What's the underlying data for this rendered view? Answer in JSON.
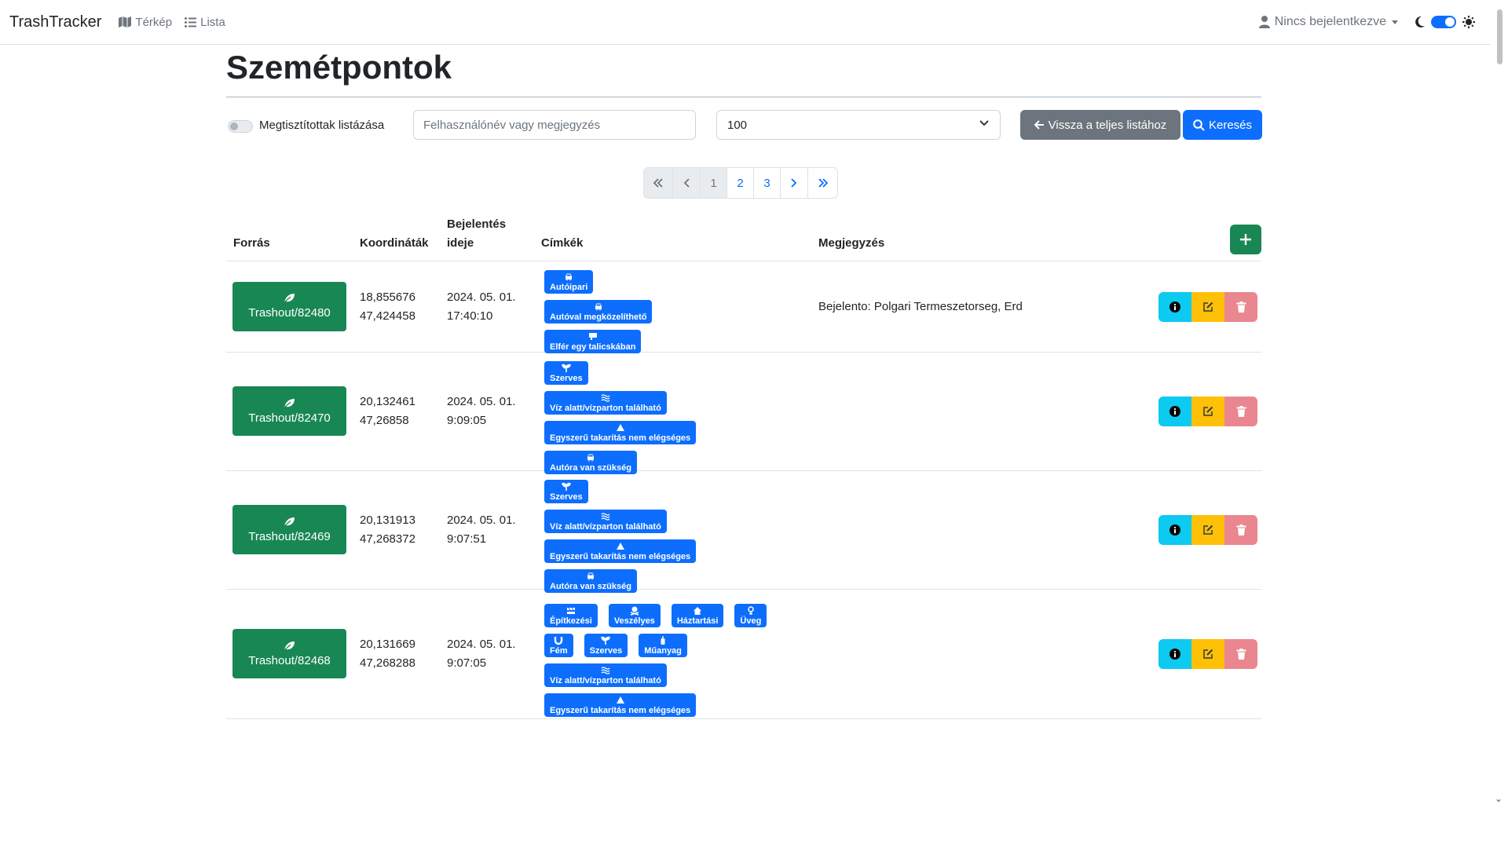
{
  "navbar": {
    "brand": "TrashTracker",
    "links": [
      {
        "label": "Térkép",
        "icon": "map-icon"
      },
      {
        "label": "Lista",
        "icon": "list-icon"
      }
    ],
    "user_menu": {
      "label": "Nincs bejelentkezve",
      "icon": "person-icon"
    },
    "theme_toggle": {
      "left_icon": "moon-icon",
      "right_icon": "sun-icon",
      "on": true
    }
  },
  "page": {
    "title": "Szemétpontok"
  },
  "filters": {
    "toggle_label": "Megtisztítottak listázása",
    "search_placeholder": "Felhasználónév vagy megjegyzés",
    "page_size": "100",
    "back_button": "Vissza a teljes listához",
    "search_button": "Keresés"
  },
  "pagination": {
    "first": "«",
    "prev": "‹",
    "pages": [
      "1",
      "2",
      "3"
    ],
    "next": "›",
    "last": "»",
    "current": "1"
  },
  "table": {
    "headers": {
      "source": "Forrás",
      "coords": "Koordináták",
      "date_line1": "Bejelentés",
      "date_line2": "ideje",
      "tags": "Címkék",
      "note": "Megjegyzés"
    },
    "rows": [
      {
        "source": "Trashout/82480",
        "coord_x": "18,855676",
        "coord_y": "47,424458",
        "date": "2024. 05. 01.",
        "time": "17:40:10",
        "tag_lines": [
          [
            {
              "label": "Autóipari",
              "icon": "car-icon"
            }
          ],
          [
            {
              "label": "Autóval megközelíthető",
              "icon": "car-icon"
            }
          ],
          [
            {
              "label": "Elfér egy talicskában",
              "icon": "wheelbarrow-icon"
            }
          ]
        ],
        "note": "Bejelento: Polgari Termeszetorseg, Erd"
      },
      {
        "source": "Trashout/82470",
        "coord_x": "20,132461",
        "coord_y": "47,26858",
        "date": "2024. 05. 01.",
        "time": "9:09:05",
        "tag_lines": [
          [
            {
              "label": "Szerves",
              "icon": "sprout-icon"
            }
          ],
          [
            {
              "label": "Víz alatt/vízparton található",
              "icon": "water-icon"
            }
          ],
          [
            {
              "label": "Egyszerű takarítás nem elégséges",
              "icon": "warning-icon"
            }
          ],
          [
            {
              "label": "Autóra van szükség",
              "icon": "car-icon"
            }
          ]
        ],
        "note": ""
      },
      {
        "source": "Trashout/82469",
        "coord_x": "20,131913",
        "coord_y": "47,268372",
        "date": "2024. 05. 01.",
        "time": "9:07:51",
        "tag_lines": [
          [
            {
              "label": "Szerves",
              "icon": "sprout-icon"
            }
          ],
          [
            {
              "label": "Víz alatt/vízparton található",
              "icon": "water-icon"
            }
          ],
          [
            {
              "label": "Egyszerű takarítás nem elégséges",
              "icon": "warning-icon"
            }
          ],
          [
            {
              "label": "Autóra van szükség",
              "icon": "car-icon"
            }
          ]
        ],
        "note": ""
      },
      {
        "source": "Trashout/82468",
        "coord_x": "20,131669",
        "coord_y": "47,268288",
        "date": "2024. 05. 01.",
        "time": "9:07:05",
        "tag_lines": [
          [
            {
              "label": "Építkezési",
              "icon": "construction-icon"
            },
            {
              "label": "Veszélyes",
              "icon": "skull-icon"
            },
            {
              "label": "Háztartási",
              "icon": "house-icon"
            },
            {
              "label": "Üveg",
              "icon": "bottle-icon"
            }
          ],
          [
            {
              "label": "Fém",
              "icon": "magnet-icon"
            },
            {
              "label": "Szerves",
              "icon": "sprout-icon"
            },
            {
              "label": "Műanyag",
              "icon": "plastic-bottle-icon"
            }
          ],
          [
            {
              "label": "Víz alatt/vízparton található",
              "icon": "water-icon"
            }
          ],
          [
            {
              "label": "Egyszerű takarítás nem elégséges",
              "icon": "warning-icon"
            }
          ]
        ],
        "note": ""
      }
    ]
  },
  "colors": {
    "primary": "#0d6efd",
    "success": "#198754",
    "secondary": "#6c757d",
    "info": "#0dcaf0",
    "warning": "#ffc107",
    "danger_light": "#ea868f"
  }
}
